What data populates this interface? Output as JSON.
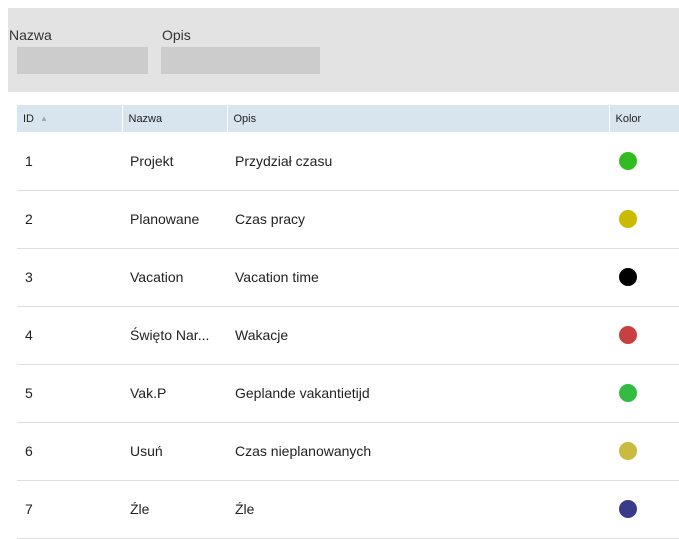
{
  "filters": {
    "name_label": "Nazwa",
    "desc_label": "Opis",
    "name_value": "",
    "desc_value": ""
  },
  "table": {
    "headers": {
      "id": "ID",
      "name": "Nazwa",
      "desc": "Opis",
      "color": "Kolor"
    },
    "rows": [
      {
        "id": "1",
        "name": "Projekt",
        "desc": "Przydział czasu",
        "color": "#33bb22"
      },
      {
        "id": "2",
        "name": "Planowane",
        "desc": "Czas pracy",
        "color": "#c8bb00"
      },
      {
        "id": "3",
        "name": "Vacation",
        "desc": "Vacation time",
        "color": "#000000"
      },
      {
        "id": "4",
        "name": "Święto Nar...",
        "desc": "Wakacje",
        "color": "#c84040"
      },
      {
        "id": "5",
        "name": "Vak.P",
        "desc": "Geplande vakantietijd",
        "color": "#33bb44"
      },
      {
        "id": "6",
        "name": "Usuń",
        "desc": "Czas nieplanowanych",
        "color": "#c8bb40"
      },
      {
        "id": "7",
        "name": "Źle",
        "desc": "Źle",
        "color": "#3a3a8a"
      }
    ]
  }
}
